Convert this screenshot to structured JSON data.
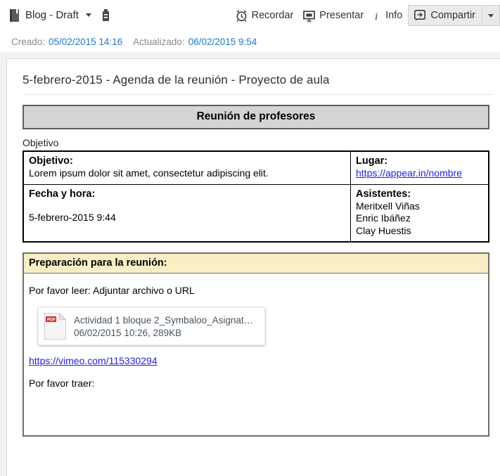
{
  "toolbar": {
    "notebook_title": "Blog - Draft",
    "notebook_icon": "notebook-icon",
    "tag_icon": "tag-icon",
    "dropdown_icon": "chevron-down-icon",
    "actions": [
      {
        "label": "Recordar",
        "icon": "alarm-clock-icon",
        "name": "remind-button"
      },
      {
        "label": "Presentar",
        "icon": "presentation-screen-icon",
        "name": "present-button"
      },
      {
        "label": "Info",
        "icon": "info-italic-icon",
        "name": "info-button"
      }
    ],
    "share": {
      "label": "Compartir",
      "icon": "share-arrow-icon",
      "arrow_icon": "chevron-down-icon"
    }
  },
  "meta": {
    "created_label": "Creado:",
    "created_value": "05/02/2015 14:16",
    "updated_label": "Actualizado:",
    "updated_value": "06/02/2015 9:54"
  },
  "document": {
    "title": "5-febrero-2015 - Agenda de la reunión - Proyecto de aula",
    "banner": "Reunión de profesores",
    "objetivo_caption": "Objetivo",
    "table": {
      "objetivo_header": "Objetivo:",
      "objetivo_text": "Lorem ipsum dolor sit amet, consectetur adipiscing elit.",
      "lugar_header": "Lugar:",
      "lugar_link": "https://appear.in/nombre",
      "fecha_header": "Fecha y hora:",
      "fecha_text": "5-febrero-2015 9:44",
      "asistentes_header": "Asistentes:",
      "asistentes": [
        "Meritxell Viñas",
        "Enric Ibáñez",
        "Clay Huestis"
      ]
    },
    "preparation": {
      "header": "Preparación para la reunión:",
      "read_line": "Por favor leer: Adjuntar archivo o URL",
      "attachment": {
        "icon": "pdf-file-icon",
        "badge": "PDF",
        "name": "Actividad 1 bloque 2_Symbaloo_Asignat…",
        "meta": "06/02/2015 10:26, 289KB"
      },
      "video_link": "https://vimeo.com/115330294",
      "bring_line": "Por favor traer:"
    }
  },
  "colors": {
    "link_blue": "#2222dd",
    "meta_blue": "#2277cc",
    "banner_gray": "#d4d4d4",
    "prep_yellow": "#faeec5",
    "pdf_red": "#d42b26",
    "canvas_gray": "#f2f2f2"
  }
}
